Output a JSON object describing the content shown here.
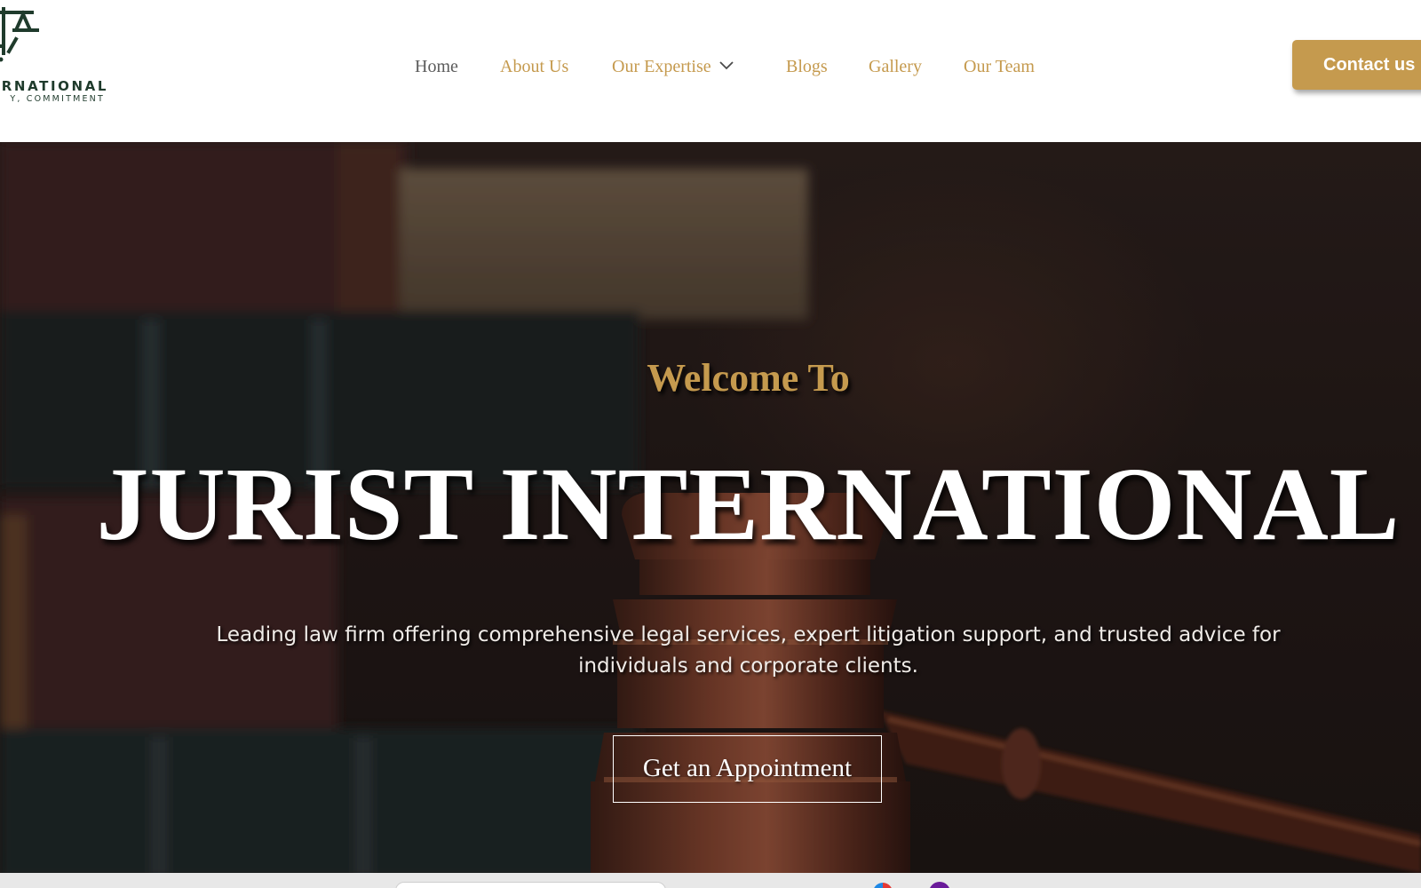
{
  "brand": {
    "name_visible": "RNATIONAL",
    "tagline_visible": "Y, COMMITMENT",
    "color_dark_green": "#1f3b2c"
  },
  "nav": {
    "items": [
      {
        "label": "Home",
        "active": true
      },
      {
        "label": "About Us"
      },
      {
        "label": "Our Expertise",
        "has_dropdown": true
      },
      {
        "label": "Blogs"
      },
      {
        "label": "Gallery"
      },
      {
        "label": "Our Team"
      }
    ],
    "dropdown_icon": "chevron-down-icon",
    "cta_label": "Contact us"
  },
  "hero": {
    "welcome": "Welcome To",
    "title": "JURIST INTERNATIONAL",
    "description": "Leading law firm offering comprehensive legal services, expert litigation support, and trusted advice for individuals and corporate clients.",
    "button_label": "Get an Appointment",
    "background_image": "gavel-and-law-books"
  },
  "colors": {
    "accent_gold": "#c59a4e",
    "nav_active": "#5b5b5b",
    "hero_text": "#ffffff"
  }
}
